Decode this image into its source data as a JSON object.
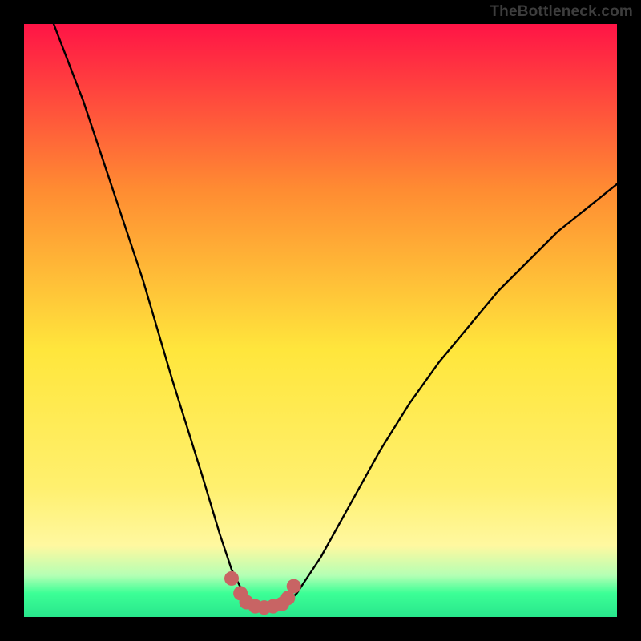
{
  "watermark": {
    "text": "TheBottleneck.com"
  },
  "colors": {
    "page_bg": "#000000",
    "watermark": "#3d3d3d",
    "curve": "#000000",
    "markers": "#c86464",
    "gradient_top": "#ff1446",
    "gradient_mid_upper": "#ff8c32",
    "gradient_mid": "#ffe63c",
    "gradient_lower": "#fff8a0",
    "gradient_green_light": "#b4ffb4",
    "gradient_green": "#3cff96",
    "gradient_green_deep": "#28e68c"
  },
  "chart_data": {
    "type": "line",
    "title": "",
    "xlabel": "",
    "ylabel": "",
    "x_range": [
      0,
      100
    ],
    "y_range": [
      0,
      100
    ],
    "series": [
      {
        "name": "bottleneck-curve",
        "x": [
          5,
          10,
          15,
          20,
          25,
          30,
          33,
          35,
          37,
          39,
          40,
          42,
          44,
          46,
          50,
          55,
          60,
          65,
          70,
          75,
          80,
          85,
          90,
          95,
          100
        ],
        "values": [
          100,
          87,
          72,
          57,
          40,
          24,
          14,
          8,
          4,
          2,
          1.5,
          1.5,
          2,
          4,
          10,
          19,
          28,
          36,
          43,
          49,
          55,
          60,
          65,
          69,
          73
        ]
      }
    ],
    "markers": {
      "name": "valley-points",
      "x": [
        35,
        36.5,
        37.5,
        39,
        40.5,
        42,
        43.5,
        44.5,
        45.5
      ],
      "values": [
        6.5,
        4,
        2.5,
        1.8,
        1.6,
        1.8,
        2.2,
        3.2,
        5.2
      ]
    }
  }
}
